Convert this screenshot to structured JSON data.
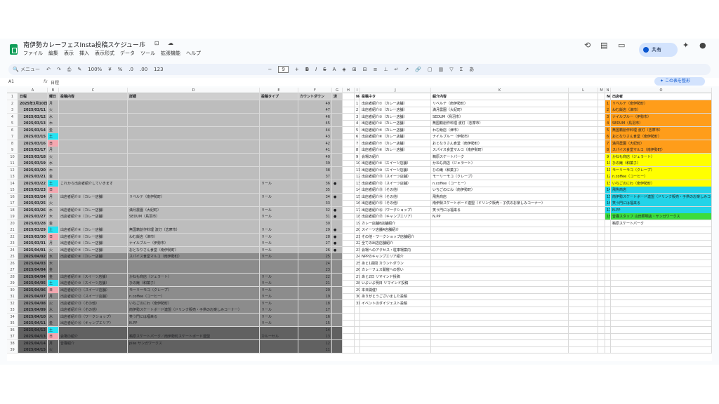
{
  "doc": {
    "title": "南伊勢カレーフェスInsta投稿スケジュール",
    "title_icons": "☆ ⊡ ☁"
  },
  "menu": [
    "ファイル",
    "編集",
    "表示",
    "挿入",
    "表示形式",
    "データ",
    "ツール",
    "拡張機能",
    "ヘルプ"
  ],
  "share_label": "共有",
  "toolbar": {
    "search": "メニュー",
    "zoom": "100%",
    "currency": "¥",
    "percent": "%",
    "dec1": ".0",
    "dec2": ".00",
    "fmt": "123",
    "font_size": "9"
  },
  "formula": {
    "cell": "A1",
    "value": "日程"
  },
  "add_table_label": "この表を整形",
  "columns": [
    "A",
    "B",
    "C",
    "D",
    "E",
    "F",
    "G",
    "H",
    "I",
    "J",
    "K",
    "L",
    "M",
    "N",
    "O"
  ],
  "left_header": [
    "日程",
    "曜日",
    "投稿内容",
    "詳細",
    "投稿タイプ",
    "カウントダウン",
    "済"
  ],
  "left_rows": [
    [
      "2025年3月10日",
      "月",
      "",
      "",
      "",
      "49",
      ""
    ],
    [
      "2025/03/11",
      "火",
      "",
      "",
      "",
      "47",
      ""
    ],
    [
      "2025/03/12",
      "水",
      "",
      "",
      "",
      "46",
      ""
    ],
    [
      "2025/03/13",
      "木",
      "",
      "",
      "",
      "45",
      ""
    ],
    [
      "2025/03/14",
      "金",
      "",
      "",
      "",
      "44",
      ""
    ],
    [
      "2025/03/15",
      "土",
      "",
      "",
      "",
      "43",
      ""
    ],
    [
      "2025/03/16",
      "日",
      "",
      "",
      "",
      "42",
      ""
    ],
    [
      "2025/03/17",
      "月",
      "",
      "",
      "",
      "41",
      ""
    ],
    [
      "2025/03/18",
      "火",
      "",
      "",
      "",
      "40",
      ""
    ],
    [
      "2025/03/19",
      "水",
      "",
      "",
      "",
      "39",
      ""
    ],
    [
      "2025/03/20",
      "木",
      "",
      "",
      "",
      "38",
      ""
    ],
    [
      "2025/03/21",
      "金",
      "",
      "",
      "",
      "37",
      ""
    ],
    [
      "2025/03/22",
      "土",
      "これから出店者紹介していきます",
      "",
      "リール",
      "36",
      "●"
    ],
    [
      "2025/03/23",
      "日",
      "",
      "",
      "",
      "35",
      ""
    ],
    [
      "2025/03/24",
      "月",
      "出店者紹介①（カレー店舗）",
      "リベルテ（南伊勢町）",
      "リール",
      "34",
      "●"
    ],
    [
      "2025/03/25",
      "火",
      "",
      "",
      "",
      "33",
      ""
    ],
    [
      "2025/03/26",
      "水",
      "出店者紹介②（カレー店舗）",
      "満月農園（大紀町）",
      "リール",
      "32",
      "●"
    ],
    [
      "2025/03/27",
      "木",
      "出店者紹介③（カレー店舗）",
      "SEDUM（鳥羽市）",
      "リール",
      "31",
      "●"
    ],
    [
      "2025/03/28",
      "金",
      "",
      "",
      "",
      "30",
      ""
    ],
    [
      "2025/03/29",
      "土",
      "出店者紹介④（カレー店舗）",
      "無国籍創作料理 波灯（志摩市）",
      "リール",
      "29",
      "●"
    ],
    [
      "2025/03/30",
      "日",
      "出店者紹介⑤（カレー店舗）",
      "わむ飯店（津市）",
      "リール",
      "28",
      "●"
    ],
    [
      "2025/03/31",
      "月",
      "出店者紹介⑥（カレー店舗）",
      "ナイルブルー（伊勢市）",
      "リール",
      "27",
      "●"
    ],
    [
      "2025/04/01",
      "火",
      "出店者紹介⑦（カレー店舗）",
      "おとなりさん食堂（南伊勢町）",
      "リール",
      "26",
      "●"
    ],
    [
      "2025/04/02",
      "水",
      "出店者紹介⑧（カレー店舗）",
      "スパイス食堂マルコ（南伊勢町）",
      "リール",
      "25",
      ""
    ],
    [
      "2025/04/03",
      "木",
      "",
      "",
      "",
      "24",
      ""
    ],
    [
      "2025/04/04",
      "金",
      "",
      "",
      "",
      "23",
      ""
    ],
    [
      "2025/04/04",
      "金",
      "出店者紹介⑨（スイーツ店舗）",
      "かねも商店（ジェラート）",
      "リール",
      "22",
      ""
    ],
    [
      "2025/04/05",
      "土",
      "出店者紹介⑩（スイーツ店舗）",
      "ひの庵（和菓子）",
      "リール",
      "21",
      ""
    ],
    [
      "2025/04/06",
      "日",
      "出店者紹介⑪（スイーツ店舗）",
      "モーリーモコ（クレープ）",
      "リール",
      "20",
      ""
    ],
    [
      "2025/04/07",
      "月",
      "出店者紹介⑫（スイーツ店舗）",
      "n.coffee（コーヒー）",
      "リール",
      "19",
      ""
    ],
    [
      "2025/04/08",
      "火",
      "出店者紹介⑬（その他）",
      "いちごのにわ（南伊勢町）",
      "リール",
      "18",
      ""
    ],
    [
      "2025/04/09",
      "水",
      "出店者紹介⑭（その他）",
      "南伊勢スケートボード連盟（ドリンク販売・子供のお楽しみコーナー）",
      "リール",
      "17",
      ""
    ],
    [
      "2025/04/10",
      "木",
      "出店者紹介⑮（ワークショップ）",
      "笑う門には福来る",
      "リール",
      "16",
      ""
    ],
    [
      "2025/04/11",
      "金",
      "出店者紹介⑯（キャンプエリア）",
      "N.PP",
      "リール",
      "15",
      ""
    ],
    [
      "2025/04/12",
      "土",
      "",
      "",
      "",
      "14",
      ""
    ],
    [
      "2025/04/13",
      "日",
      "会場の紹介",
      "鵜原スケートパーク／南伊勢町スケートボード連盟",
      "カルーセル",
      "13",
      ""
    ],
    [
      "2025/04/14",
      "月",
      "音響紹介",
      "pike サンガワークス",
      "",
      "12",
      ""
    ],
    [
      "2025/04/15",
      "火",
      "",
      "",
      "",
      "11",
      ""
    ]
  ],
  "mid_header": [
    "No.",
    "投稿ネタ",
    "紹介内容"
  ],
  "mid_rows": [
    [
      "1",
      "出店者紹介①（カレー店舗）",
      "リベルテ（南伊勢町）"
    ],
    [
      "2",
      "出店者紹介②（カレー店舗）",
      "満月農園（大紀町）"
    ],
    [
      "3",
      "出店者紹介③（カレー店舗）",
      "SEDUM（鳥羽市）"
    ],
    [
      "4",
      "出店者紹介④（カレー店舗）",
      "無国籍創作料理 波灯（志摩市）"
    ],
    [
      "5",
      "出店者紹介⑤（カレー店舗）",
      "わむ飯店（津市）"
    ],
    [
      "6",
      "出店者紹介⑥（カレー店舗）",
      "ナイルブルー（伊勢市）"
    ],
    [
      "7",
      "出店者紹介⑦（カレー店舗）",
      "おとなりさん食堂（南伊勢町）"
    ],
    [
      "8",
      "出店者紹介⑧（カレー店舗）",
      "スパイス食堂マルコ（南伊勢町）"
    ],
    [
      "9",
      "会場の紹介",
      "鵜原スケートパーク"
    ],
    [
      "10",
      "出店者紹介⑨（スイーツ店舗）",
      "かねも商店（ジェラート）"
    ],
    [
      "11",
      "出店者紹介⑩（スイーツ店舗）",
      "ひの庵（和菓子）"
    ],
    [
      "12",
      "出店者紹介⑪（スイーツ店舗）",
      "モーリーモコ（クレープ）"
    ],
    [
      "13",
      "出店者紹介⑫（スイーツ店舗）",
      "n.coffee（コーヒー）"
    ],
    [
      "14",
      "出店者紹介⑬（その他）",
      "いちごのにわ（南伊勢町）"
    ],
    [
      "15",
      "出店者紹介⑭（その他）",
      "飛魚商店"
    ],
    [
      "16",
      "出店者紹介⑮（その他）",
      "南伊勢スケートボード連盟（ドリンク販売・子供のお楽しみコーナー）"
    ],
    [
      "17",
      "出店者紹介⑯（ワークショップ）",
      "笑う門には福来る"
    ],
    [
      "18",
      "出店者紹介⑰（キャンプエリア）",
      "N.PP"
    ],
    [
      "19",
      "カレー店舗8店舗紹介",
      ""
    ],
    [
      "20",
      "スイーツ店舗4店舗紹介",
      ""
    ],
    [
      "21",
      "その他・ワークショップ店舗紹介",
      ""
    ],
    [
      "22",
      "全ての出店店舗紹介",
      ""
    ],
    [
      "23",
      "会場へのアクセス・駐車場案内",
      ""
    ],
    [
      "24",
      "NPPのキャンプエリア紹介",
      ""
    ],
    [
      "25",
      "あと1週間 カウントダウン",
      ""
    ],
    [
      "26",
      "カレーフェス開催への想い",
      ""
    ],
    [
      "27",
      "あと2日 リマインド投稿",
      ""
    ],
    [
      "28",
      "いよいよ明日 リマインド投稿",
      ""
    ],
    [
      "29",
      "本日開催！",
      ""
    ],
    [
      "30",
      "ありがとうございました投稿",
      ""
    ],
    [
      "31",
      "イベントのダイジェスト投稿",
      ""
    ]
  ],
  "right_header": [
    "No.",
    "出店者"
  ],
  "right_rows": [
    [
      "1",
      "リベルテ（南伊勢町）"
    ],
    [
      "2",
      "わむ飯店（津市）"
    ],
    [
      "3",
      "ナイルブルー（伊勢市）"
    ],
    [
      "4",
      "SEDUM（鳥羽市）"
    ],
    [
      "5",
      "無国籍創作料理 波灯（志摩市）"
    ],
    [
      "6",
      "おとなりさん食堂（南伊勢町）"
    ],
    [
      "7",
      "満月農園（大紀町）"
    ],
    [
      "8",
      "スパイス食堂マルコ（南伊勢町）"
    ],
    [
      "9",
      "かねも商店（ジェラート）"
    ],
    [
      "10",
      "ひの庵（和菓子）"
    ],
    [
      "11",
      "モーリーモコ（クレープ）"
    ],
    [
      "12",
      "n.coffee（コーヒー）"
    ],
    [
      "13",
      "いちごのにわ（南伊勢町）"
    ],
    [
      "14",
      "飛魚商店"
    ],
    [
      "15",
      "南伊勢スケートボード連盟（ドリンク販売・子供のお楽しみコーナー）"
    ],
    [
      "16",
      "笑う門には福来る"
    ],
    [
      "17",
      "N.PP"
    ],
    [
      "18",
      "音響スタッフ 山田照明店・サンガワークス"
    ],
    [
      "",
      "鵜原スケートパーク"
    ]
  ],
  "colors": {
    "orange": "#ff9d1a",
    "yellow": "#ffff00",
    "cyan": "#22d3e8",
    "green": "#3cdc3c",
    "header_gray": "#cfcfcf"
  }
}
